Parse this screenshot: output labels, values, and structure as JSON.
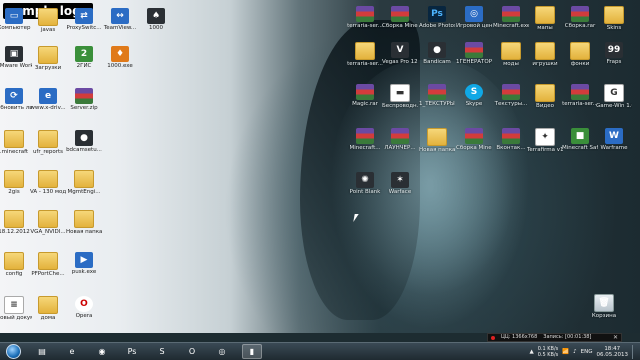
{
  "watermark": "sample logo",
  "desktop_icons": [
    {
      "id": "computer",
      "label": "Компьютер",
      "icon": "computer-icon",
      "kind": "app-blue",
      "glyph": "▭"
    },
    {
      "id": "javas",
      "label": "javas",
      "icon": "folder-icon",
      "kind": "folder",
      "glyph": ""
    },
    {
      "id": "proxyswitch",
      "label": "ProxySwitc...",
      "icon": "proxy-icon",
      "kind": "app-blue",
      "glyph": "⇄"
    },
    {
      "id": "teamviewer",
      "label": "TeamView...",
      "icon": "teamviewer-icon",
      "kind": "app-blue",
      "glyph": "↔"
    },
    {
      "id": "1000",
      "label": "1000",
      "icon": "game-icon",
      "kind": "app-dark",
      "glyph": "♠"
    },
    {
      "id": "vmware",
      "label": "VMware Workstation",
      "icon": "vmware-icon",
      "kind": "app-dark",
      "glyph": "▣"
    },
    {
      "id": "zagruzki",
      "label": "Загрузки",
      "icon": "folder-icon",
      "kind": "folder",
      "glyph": ""
    },
    {
      "id": "2gis",
      "label": "2ГИС",
      "icon": "2gis-icon",
      "kind": "app-green",
      "glyph": "2"
    },
    {
      "id": "1000exe",
      "label": "1000.exe",
      "icon": "exe-icon",
      "kind": "app-orange",
      "glyph": "♦"
    },
    {
      "id": "update",
      "label": "Обновить лицензи...",
      "icon": "update-icon",
      "kind": "app-blue",
      "glyph": "⟳"
    },
    {
      "id": "wwwxdriv",
      "label": "www.x-driv...",
      "icon": "ie-icon",
      "kind": "app-blue",
      "glyph": "e"
    },
    {
      "id": "serverzip",
      "label": "Server.zip",
      "icon": "archive-icon",
      "kind": "archive",
      "glyph": ""
    },
    {
      "id": "minecraft",
      "label": ".minecraft",
      "icon": "folder-icon",
      "kind": "folder",
      "glyph": ""
    },
    {
      "id": "ufr",
      "label": "ufr_reports",
      "icon": "folder-icon",
      "kind": "folder",
      "glyph": ""
    },
    {
      "id": "bdcam",
      "label": "bdcamsetu...",
      "icon": "bdcam-icon",
      "kind": "app-dark",
      "glyph": "●"
    },
    {
      "id": "2gis2",
      "label": "2gis",
      "icon": "folder-icon",
      "kind": "folder",
      "glyph": ""
    },
    {
      "id": "va130",
      "label": "VA - 130 модных...",
      "icon": "folder-icon",
      "kind": "folder",
      "glyph": ""
    },
    {
      "id": "mgmt",
      "label": "MgmtEngi...",
      "icon": "folder-icon",
      "kind": "folder",
      "glyph": ""
    },
    {
      "id": "date",
      "label": "18.12.2012",
      "icon": "folder-icon",
      "kind": "folder",
      "glyph": ""
    },
    {
      "id": "vgnvidia",
      "label": "VGA_NVIDI...",
      "icon": "folder-icon",
      "kind": "folder",
      "glyph": ""
    },
    {
      "id": "newfolder",
      "label": "Новая папка",
      "icon": "folder-icon",
      "kind": "folder",
      "glyph": ""
    },
    {
      "id": "config",
      "label": "config",
      "icon": "folder-icon",
      "kind": "folder",
      "glyph": ""
    },
    {
      "id": "pfport",
      "label": "PFPortChe...",
      "icon": "folder-icon",
      "kind": "folder",
      "glyph": ""
    },
    {
      "id": "pusk",
      "label": "pusk.exe",
      "icon": "exe-icon",
      "kind": "app-blue",
      "glyph": "▶"
    },
    {
      "id": "newdoc",
      "label": "Новый документ...",
      "icon": "document-icon",
      "kind": "doc",
      "glyph": "≡"
    },
    {
      "id": "doma",
      "label": "дома",
      "icon": "folder-icon",
      "kind": "folder",
      "glyph": ""
    },
    {
      "id": "opera",
      "label": "Opera",
      "icon": "opera-icon",
      "kind": "app-opera",
      "glyph": "O"
    },
    {
      "id": "terraria1",
      "label": "terraria-ser...",
      "icon": "archive-icon",
      "kind": "archive",
      "glyph": ""
    },
    {
      "id": "sborka",
      "label": "Сборка Minecraft...",
      "icon": "archive-icon",
      "kind": "archive",
      "glyph": ""
    },
    {
      "id": "adobe",
      "label": "Adobe Photosh...",
      "icon": "photoshop-icon",
      "kind": "app-ps",
      "glyph": "Ps"
    },
    {
      "id": "gamecenter",
      "label": "Игровой центр@Ma...",
      "icon": "gamecenter-icon",
      "kind": "app-blue",
      "glyph": "◎"
    },
    {
      "id": "minecraftexe",
      "label": "Minecraft.exe",
      "icon": "archive-icon",
      "kind": "archive",
      "glyph": ""
    },
    {
      "id": "mapy",
      "label": "мапы",
      "icon": "folder-icon",
      "kind": "folder",
      "glyph": ""
    },
    {
      "id": "sborka2",
      "label": "Сборка.rar",
      "icon": "archive-icon",
      "kind": "archive",
      "glyph": ""
    },
    {
      "id": "skins",
      "label": "Skins",
      "icon": "folder-icon",
      "kind": "folder",
      "glyph": ""
    },
    {
      "id": "terraria2",
      "label": "terraria-ser...",
      "icon": "folder-icon",
      "kind": "folder",
      "glyph": ""
    },
    {
      "id": "vegas",
      "label": "Vegas Pro 12.0 (64-bit)",
      "icon": "vegas-icon",
      "kind": "app-dark",
      "glyph": "V"
    },
    {
      "id": "bandicam",
      "label": "Bandicam",
      "icon": "bandicam-icon",
      "kind": "app-dark",
      "glyph": "●"
    },
    {
      "id": "gp_rar",
      "label": "1ГЕНЕРАТОР_ПАРОЛЕЙ...",
      "icon": "archive-icon",
      "kind": "archive",
      "glyph": ""
    },
    {
      "id": "mods",
      "label": "моды",
      "icon": "folder-icon",
      "kind": "folder",
      "glyph": ""
    },
    {
      "id": "igrushki",
      "label": "игрушки",
      "icon": "folder-icon",
      "kind": "folder",
      "glyph": ""
    },
    {
      "id": "fonki",
      "label": "фонки",
      "icon": "folder-icon",
      "kind": "folder",
      "glyph": ""
    },
    {
      "id": "fraps",
      "label": "Fraps",
      "icon": "fraps-icon",
      "kind": "app-dark",
      "glyph": "99"
    },
    {
      "id": "magic",
      "label": "Magic.rar",
      "icon": "archive-icon",
      "kind": "archive",
      "glyph": ""
    },
    {
      "id": "storage",
      "label": "Беспроводн...",
      "icon": "usb-icon",
      "kind": "doc",
      "glyph": "▬"
    },
    {
      "id": "tb_rar",
      "label": "1_ТЕКСТУРЫ...",
      "icon": "archive-icon",
      "kind": "archive",
      "glyph": ""
    },
    {
      "id": "skype",
      "label": "Skype",
      "icon": "skype-icon",
      "kind": "app-skype",
      "glyph": "S"
    },
    {
      "id": "tekstury",
      "label": "Текстуры...",
      "icon": "archive-icon",
      "kind": "archive",
      "glyph": ""
    },
    {
      "id": "vidyo",
      "label": "Видео",
      "icon": "folder-icon",
      "kind": "folder",
      "glyph": ""
    },
    {
      "id": "ter3",
      "label": "terraria-ser...",
      "icon": "archive-icon",
      "kind": "archive",
      "glyph": ""
    },
    {
      "id": "gamexe",
      "label": "Game-Win 1.0.0",
      "icon": "game-win-icon",
      "kind": "doc",
      "glyph": "G"
    },
    {
      "id": "mchash",
      "label": "Minecraft...",
      "icon": "archive-icon",
      "kind": "archive",
      "glyph": ""
    },
    {
      "id": "rar2",
      "label": "ЛАУНЧЕР...",
      "icon": "archive-icon",
      "kind": "archive",
      "glyph": ""
    },
    {
      "id": "np",
      "label": "Новая папка (2)",
      "icon": "folder-icon",
      "kind": "folder",
      "glyph": ""
    },
    {
      "id": "sborkamc",
      "label": "Сборка Minecraft...",
      "icon": "archive-icon",
      "kind": "archive",
      "glyph": ""
    },
    {
      "id": "vk",
      "label": "Вконтак...",
      "icon": "archive-icon",
      "kind": "archive",
      "glyph": ""
    },
    {
      "id": "terrafirma",
      "label": "Terrafirma v1.6.7",
      "icon": "terrafirma-icon",
      "kind": "doc",
      "glyph": "✦"
    },
    {
      "id": "mcsmp",
      "label": "Minecraft SafeServer...",
      "icon": "minecraft-icon",
      "kind": "app-green",
      "glyph": "■"
    },
    {
      "id": "warframe",
      "label": "Warframe",
      "icon": "warframe-icon",
      "kind": "app-blue",
      "glyph": "W"
    },
    {
      "id": "pointblank",
      "label": "Point Blank",
      "icon": "pointblank-icon",
      "kind": "app-dark",
      "glyph": "✺"
    },
    {
      "id": "warface",
      "label": "Warface",
      "icon": "warface-icon",
      "kind": "app-dark",
      "glyph": "✶"
    },
    {
      "id": "korzina",
      "label": "Корзина",
      "icon": "recycle-bin-icon",
      "kind": "recyclebin",
      "glyph": "🗑"
    }
  ],
  "recorder": {
    "resolution": "ЦЦ: 1366x768",
    "status": "Запись: [00:01:38]",
    "close_label": "✕"
  },
  "taskbar": {
    "buttons": [
      {
        "name": "explorer",
        "icon": "folder-icon",
        "glyph": "▤",
        "active": false
      },
      {
        "name": "ie",
        "icon": "ie-icon",
        "glyph": "e",
        "active": false
      },
      {
        "name": "chrome",
        "icon": "chrome-icon",
        "glyph": "◉",
        "active": false
      },
      {
        "name": "photoshop",
        "icon": "photoshop-icon",
        "glyph": "Ps",
        "active": false
      },
      {
        "name": "skype",
        "icon": "skype-icon",
        "glyph": "S",
        "active": false
      },
      {
        "name": "opera",
        "icon": "opera-icon",
        "glyph": "O",
        "active": false
      },
      {
        "name": "gamecenter",
        "icon": "gamecenter-icon",
        "glyph": "◎",
        "active": false
      },
      {
        "name": "cmd",
        "icon": "cmd-icon",
        "glyph": "▮",
        "active": true
      }
    ],
    "tray": {
      "upload": "0.1 KB/s",
      "download": "0.5 KB/s",
      "lang": "ENG",
      "time": "18:47",
      "date": "06.05.2013"
    }
  }
}
